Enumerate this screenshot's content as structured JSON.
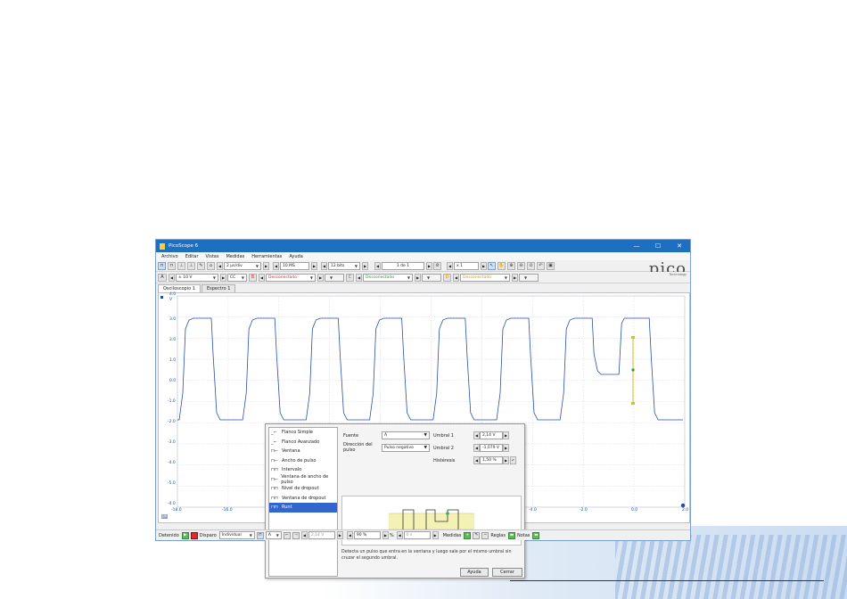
{
  "window": {
    "title": "PicoScope 6",
    "controls": {
      "minimize": "—",
      "maximize": "☐",
      "close": "✕"
    }
  },
  "menu": [
    "Archivo",
    "Editar",
    "Vistas",
    "Medidas",
    "Herramientas",
    "Ayuda"
  ],
  "toolbar": {
    "timebase": "2 µs/div",
    "samples": "10 MS",
    "resolution": "12 bits",
    "capture_page": "1 de 1",
    "zoom": "x 1"
  },
  "channels": [
    {
      "letter": "A",
      "range": "± 10 V",
      "coupling": "CC",
      "color": "#1f4fa0"
    },
    {
      "letter": "B",
      "range": "Desconectado",
      "coupling": "",
      "color": "#d03030"
    },
    {
      "letter": "C",
      "range": "Desconectado",
      "coupling": "",
      "color": "#2a9a3a"
    },
    {
      "letter": "D",
      "range": "Desconectado",
      "coupling": "",
      "color": "#d49a10"
    }
  ],
  "logo": {
    "text": "pico",
    "sub": "Technology"
  },
  "tabs": [
    {
      "label": "Osciloscopio 1"
    },
    {
      "label": "Espectro 1"
    }
  ],
  "scope": {
    "y_unit": "V",
    "y_ticks": [
      "4.0",
      "3.0",
      "2.0",
      "1.0",
      "0.0",
      "-1.0",
      "-2.0",
      "-3.0",
      "-4.0",
      "-5.0",
      "-4.0"
    ],
    "x_unit": "µs",
    "x_ticks": [
      "-18.0",
      "-16.0",
      "-4.0",
      "-2.0",
      "0.0",
      "2.0"
    ]
  },
  "dialog": {
    "trigger_types": [
      {
        "label": "Flanco Simple",
        "icon": "_⌐"
      },
      {
        "label": "Flanco Avanzado",
        "icon": "_⌐"
      },
      {
        "label": "Ventana",
        "icon": "⊓⌐"
      },
      {
        "label": "Ancho de pulso",
        "icon": "⊓⌐"
      },
      {
        "label": "Intervalo",
        "icon": "⊓⊓"
      },
      {
        "label": "Ventana de ancho de pulso",
        "icon": "⊓⌐"
      },
      {
        "label": "Nivel de dropout",
        "icon": "⊓⊓"
      },
      {
        "label": "Ventana de dropout",
        "icon": "⊓⊓"
      },
      {
        "label": "Runt",
        "icon": "⊓⊓"
      }
    ],
    "selected_index": 8,
    "source_label": "Fuente",
    "source_value": "A",
    "direction_label": "Dirección del pulso",
    "direction_value": "Pulso negativo",
    "threshold1_label": "Umbral 1",
    "threshold1_value": "2,14 V",
    "threshold2_label": "Umbral 2",
    "threshold2_value": "-1,079 V",
    "hysteresis_label": "Histéresis",
    "hysteresis_value": "1,50 %",
    "description": "Detecta un pulso que entra en la ventana y luego sale por el mismo umbral sin cruzar el segundo umbral.",
    "help_button": "Ayuda",
    "close_button": "Cerrar"
  },
  "status": {
    "state": "Detenido",
    "trigger_label": "Disparo",
    "trigger_mode": "Individual",
    "trigger_channel": "A",
    "level": "2,14 V",
    "pretrigger": "90 %",
    "pretrigger_unit": "%",
    "delay": "0 s",
    "measurements": "Medidas",
    "rulers": "Reglas",
    "notes": "Notas"
  }
}
